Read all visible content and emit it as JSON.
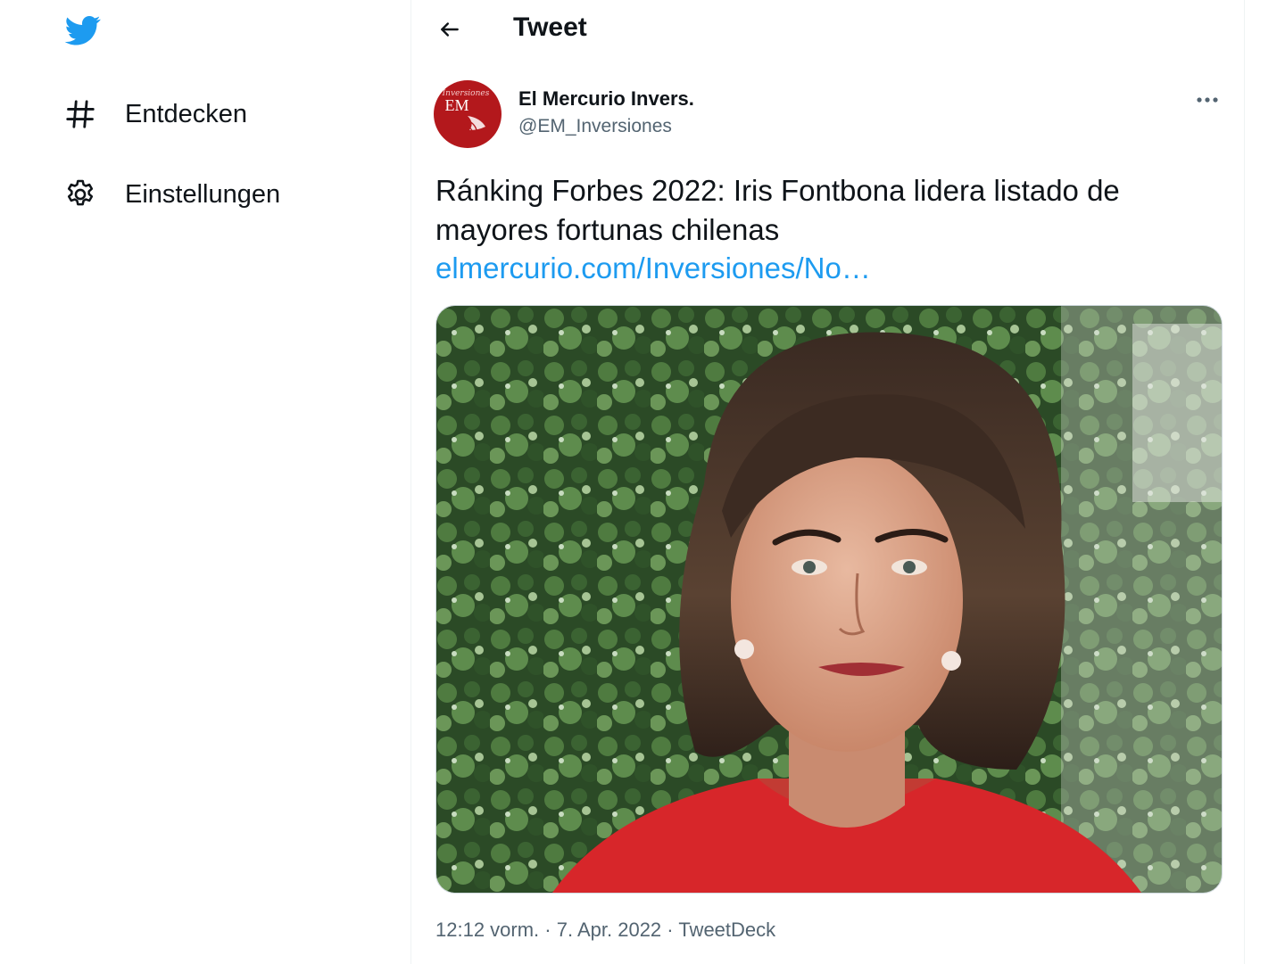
{
  "sidebar": {
    "logo_icon": "twitter-bird-icon",
    "items": [
      {
        "label": "Entdecken",
        "icon": "hashtag-icon"
      },
      {
        "label": "Einstellungen",
        "icon": "gear-icon"
      }
    ]
  },
  "header": {
    "back_icon": "arrow-left-icon",
    "title": "Tweet"
  },
  "tweet": {
    "author": {
      "name": "El Mercurio Invers.",
      "handle": "@EM_Inversiones",
      "avatar_text_top": "Inversiones",
      "avatar_text_main": "EM"
    },
    "more_icon": "more-horizontal-icon",
    "text": "Ránking Forbes 2022: Iris Fontbona lidera listado de mayores fortunas chilenas",
    "link": "elmercurio.com/Inversiones/No…",
    "image_description_icon": "tweet-photo",
    "time": "12:12 vorm.",
    "separator": " · ",
    "date": "7. Apr. 2022",
    "source": "TweetDeck"
  },
  "colors": {
    "brand_blue": "#1d9bf0",
    "text_primary": "#0f1419",
    "text_secondary": "#536471",
    "avatar_red": "#b3181c"
  }
}
